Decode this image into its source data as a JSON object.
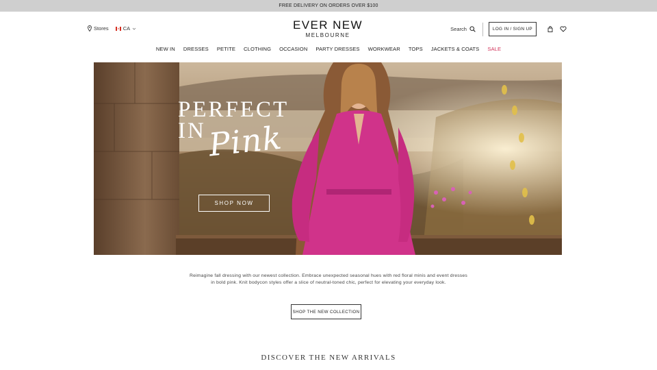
{
  "promo": {
    "text": "FREE DELIVERY ON ORDERS OVER $100"
  },
  "header": {
    "stores_label": "Stores",
    "country_label": "CA",
    "brand": "EVER NEW",
    "city": "MELBOURNE",
    "search_label": "Search",
    "login_label": "LOG IN / SIGN UP"
  },
  "nav": {
    "items": [
      "NEW IN",
      "DRESSES",
      "PETITE",
      "CLOTHING",
      "OCCASION",
      "PARTY DRESSES",
      "WORKWEAR",
      "TOPS",
      "JACKETS & COATS",
      "SALE"
    ]
  },
  "hero": {
    "title_line1": "PERFECT",
    "title_line2": "IN",
    "script": "Pink",
    "cta": "SHOP NOW"
  },
  "content": {
    "description_line1": "Reimagine fall dressing with our newest collection. Embrace unexpected seasonal hues with red floral minis and event dresses",
    "description_line2": "in bold pink. Knit bodycon styles offer a slice of neutral-toned chic, perfect for elevating your everyday look.",
    "collection_button": "SHOP THE NEW COLLECTION",
    "section_title": "DISCOVER THE NEW ARRIVALS"
  },
  "colors": {
    "sale": "#d2325a",
    "promo_bg": "#cfcfcf",
    "dress": "#d0338a"
  },
  "icons": [
    "location-pin-icon",
    "canada-flag-icon",
    "chevron-down-icon",
    "search-icon",
    "shopping-bag-icon",
    "heart-icon"
  ]
}
